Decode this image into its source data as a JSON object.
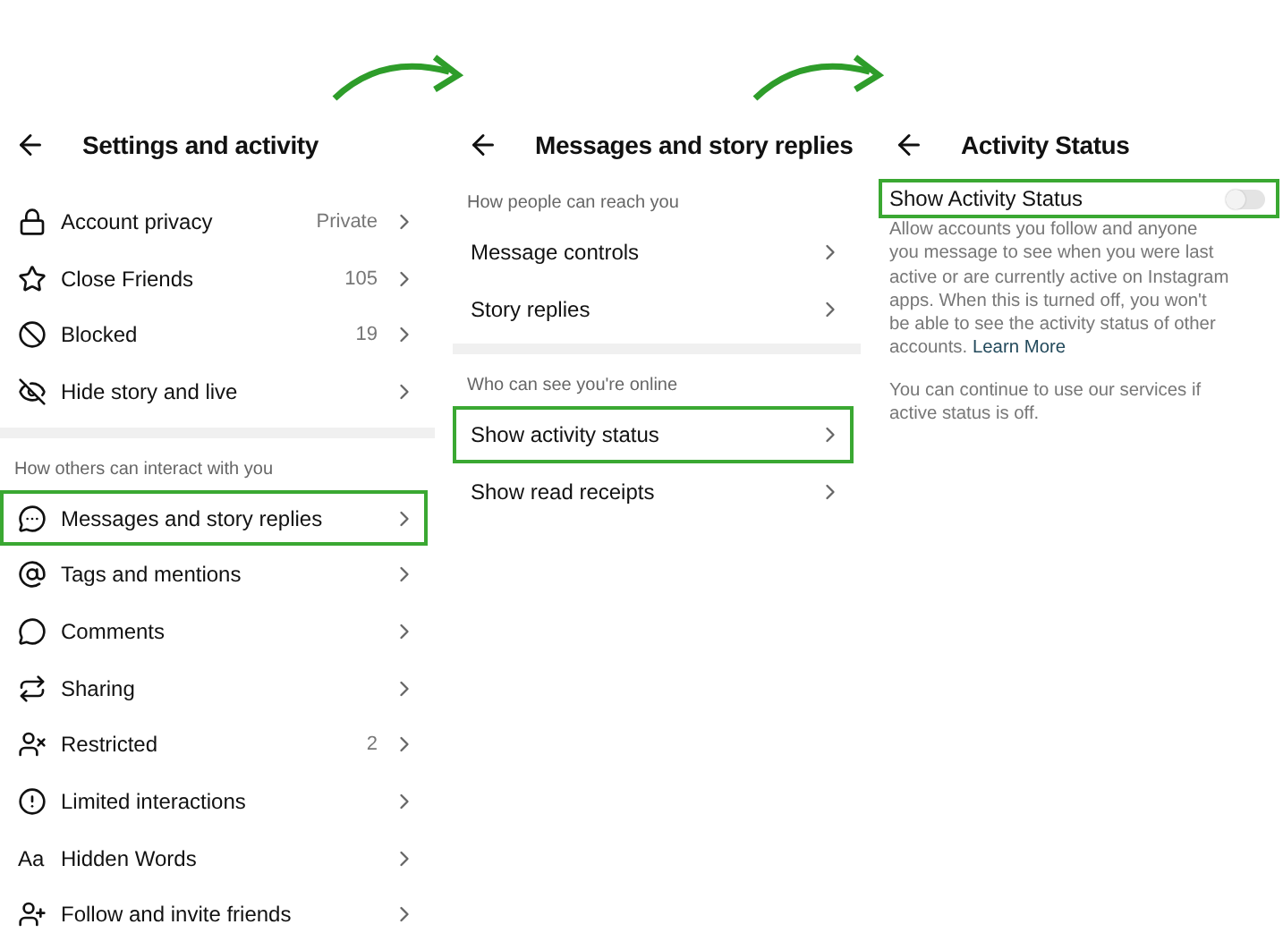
{
  "panels": [
    {
      "title": "Settings and activity",
      "sections": [
        {
          "items": [
            {
              "label": "Account privacy",
              "value": "Private",
              "highlighted": false
            },
            {
              "label": "Close Friends",
              "value": "105",
              "highlighted": false
            },
            {
              "label": "Blocked",
              "value": "19",
              "highlighted": false
            },
            {
              "label": "Hide story and live",
              "highlighted": false
            }
          ]
        },
        {
          "heading": "How others can interact with you",
          "items": [
            {
              "label": "Messages and story replies",
              "highlighted": true
            },
            {
              "label": "Tags and mentions",
              "highlighted": false
            },
            {
              "label": "Comments",
              "highlighted": false
            },
            {
              "label": "Sharing",
              "highlighted": false
            },
            {
              "label": "Restricted",
              "value": "2",
              "highlighted": false
            },
            {
              "label": "Limited interactions",
              "highlighted": false
            },
            {
              "label": "Hidden Words",
              "icon_text": "Aa",
              "highlighted": false
            },
            {
              "label": "Follow and invite friends",
              "highlighted": false
            }
          ]
        }
      ]
    },
    {
      "title": "Messages and story replies",
      "sections": [
        {
          "heading": "How people can reach you",
          "items": [
            {
              "label": "Message controls",
              "highlighted": false
            },
            {
              "label": "Story replies",
              "highlighted": false
            }
          ]
        },
        {
          "heading": "Who can see you're online",
          "items": [
            {
              "label": "Show activity status",
              "highlighted": true
            },
            {
              "label": "Show read receipts",
              "highlighted": false
            }
          ]
        }
      ]
    },
    {
      "title": "Activity Status",
      "toggle": {
        "label": "Show Activity Status",
        "on": false,
        "highlighted": true
      },
      "paragraphs": [
        "Allow accounts you follow and anyone you message to see when you were last active or are currently active on Instagram apps. When this is turned off, you won't be able to see the activity status of other accounts.",
        "You can continue to use our services if active status is off."
      ],
      "link": "Learn More"
    }
  ]
}
